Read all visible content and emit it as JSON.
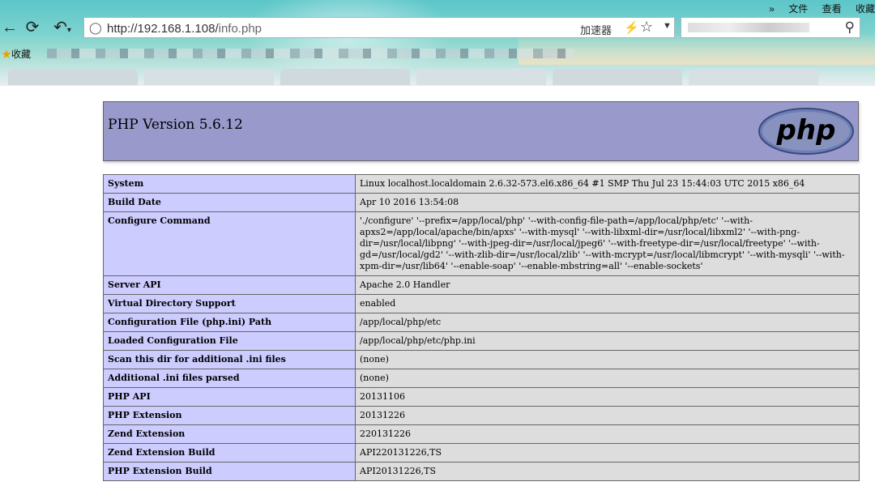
{
  "browser": {
    "menu": {
      "more": "»",
      "file": "文件",
      "view": "查看",
      "favorites": "收藏"
    },
    "url": "http://192.168.1.108/info.php",
    "url_host": "http://192.168.1.108/",
    "url_path": "info.php",
    "accelerator": "加速器",
    "bookmarks_label": "收藏"
  },
  "phpinfo": {
    "title": "PHP Version 5.6.12",
    "logo_text": "php",
    "rows": [
      {
        "key": "System",
        "value": "Linux localhost.localdomain 2.6.32-573.el6.x86_64 #1 SMP Thu Jul 23 15:44:03 UTC 2015 x86_64"
      },
      {
        "key": "Build Date",
        "value": "Apr 10 2016 13:54:08"
      },
      {
        "key": "Configure Command",
        "value": "'./configure' '--prefix=/app/local/php' '--with-config-file-path=/app/local/php/etc' '--with-apxs2=/app/local/apache/bin/apxs' '--with-mysql' '--with-libxml-dir=/usr/local/libxml2' '--with-png-dir=/usr/local/libpng' '--with-jpeg-dir=/usr/local/jpeg6' '--with-freetype-dir=/usr/local/freetype' '--with-gd=/usr/local/gd2' '--with-zlib-dir=/usr/local/zlib' '--with-mcrypt=/usr/local/libmcrypt' '--with-mysqli' '--with-xpm-dir=/usr/lib64' '--enable-soap' '--enable-mbstring=all' '--enable-sockets'"
      },
      {
        "key": "Server API",
        "value": "Apache 2.0 Handler"
      },
      {
        "key": "Virtual Directory Support",
        "value": "enabled"
      },
      {
        "key": "Configuration File (php.ini) Path",
        "value": "/app/local/php/etc"
      },
      {
        "key": "Loaded Configuration File",
        "value": "/app/local/php/etc/php.ini"
      },
      {
        "key": "Scan this dir for additional .ini files",
        "value": "(none)"
      },
      {
        "key": "Additional .ini files parsed",
        "value": "(none)"
      },
      {
        "key": "PHP API",
        "value": "20131106"
      },
      {
        "key": "PHP Extension",
        "value": "20131226"
      },
      {
        "key": "Zend Extension",
        "value": "220131226"
      },
      {
        "key": "Zend Extension Build",
        "value": "API220131226,TS"
      },
      {
        "key": "PHP Extension Build",
        "value": "API20131226,TS"
      }
    ]
  },
  "colors": {
    "header_bg": "#9999cc",
    "key_bg": "#ccccff",
    "value_bg": "#dddddd"
  }
}
